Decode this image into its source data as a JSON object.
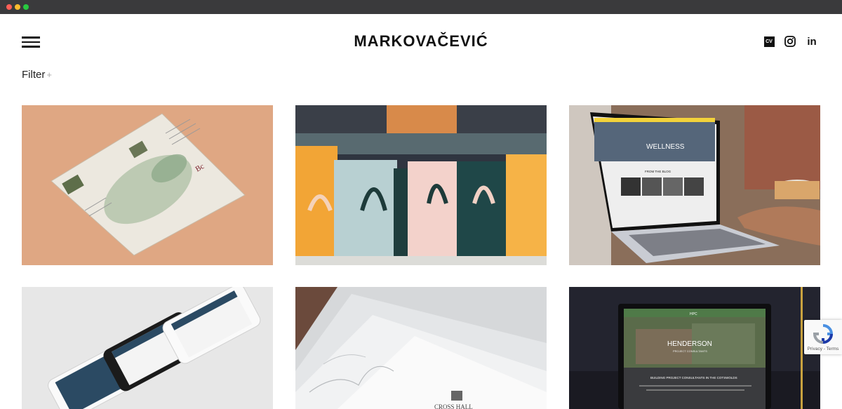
{
  "header": {
    "logo": "MARKOVAČEVIĆ",
    "cv_label": "CV",
    "linkedin_label": "in"
  },
  "filter": {
    "label": "Filter",
    "plus": "+"
  },
  "projects": [
    {
      "name": "estate-map-brochure"
    },
    {
      "name": "gift-bags"
    },
    {
      "name": "wellness-laptop",
      "headline": "WELLNESS",
      "section": "FROM THE BLOG"
    },
    {
      "name": "mobile-app-mockup"
    },
    {
      "name": "cross-hall-stationery",
      "text": "CROSS HALL"
    },
    {
      "name": "henderson-laptop",
      "brand": "HPC",
      "headline": "HENDERSON",
      "sub": "PROJECT CONSULTANTS",
      "tagline": "BUILDING PROJECT CONSULTANTS IN THE COTSWOLDS"
    }
  ],
  "recaptcha": {
    "text": "Privacy - Terms"
  }
}
